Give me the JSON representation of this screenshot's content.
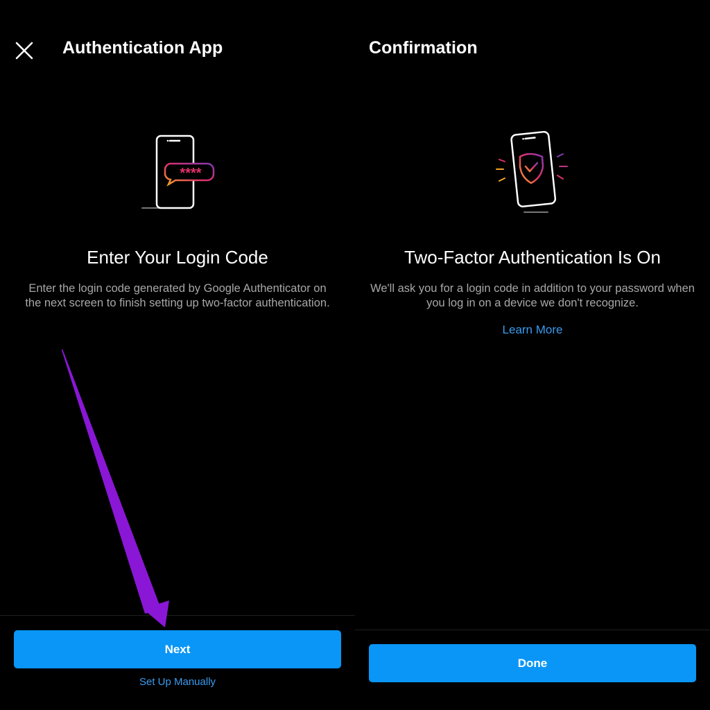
{
  "left": {
    "close_icon": "close-icon",
    "title": "Authentication App",
    "illustration": "phone-login-code-icon",
    "code_mask": "****",
    "heading": "Enter Your Login Code",
    "description": "Enter the login code generated by Google Authenticator on the next screen to finish setting up two-factor authentication.",
    "next_label": "Next",
    "manual_label": "Set Up Manually"
  },
  "right": {
    "title": "Confirmation",
    "illustration": "phone-shield-check-icon",
    "heading": "Two-Factor Authentication Is On",
    "description": "We'll ask you for a login code in addition to your password when you log in on a device we don't recognize.",
    "learn_more_label": "Learn More",
    "done_label": "Done"
  },
  "annotation": {
    "arrow": "purple-arrow-pointing-to-next-button"
  },
  "colors": {
    "background": "#000000",
    "primary_button": "#0a96f6",
    "link": "#3a9bf0",
    "secondary_text": "#a8a8a8",
    "annotation_arrow": "#8a17d6",
    "gradient_start": "#f5a623",
    "gradient_mid": "#e1306c",
    "gradient_end": "#833ab4"
  }
}
